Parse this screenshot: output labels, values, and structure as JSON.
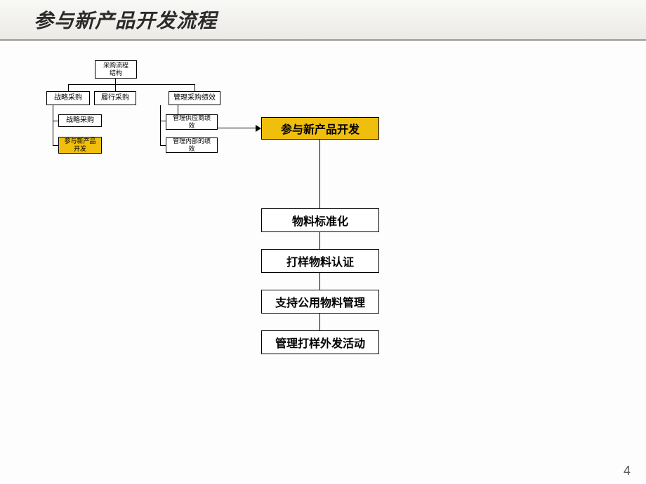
{
  "title": "参与新产品开发流程",
  "orgchart": {
    "root": "采购流程\n结构",
    "level1": {
      "a": "战略采购",
      "b": "履行采购",
      "c": "管理采购绩效"
    },
    "level2": {
      "a1": "战略采购",
      "a2": "参与新产品\n开发",
      "c1": "管理供应商绩\n效",
      "c2": "管理内部的绩\n效"
    }
  },
  "flow": {
    "main": "参与新产品开发",
    "steps": [
      "物料标准化",
      "打样物料认证",
      "支持公用物料管理",
      "管理打样外发活动"
    ]
  },
  "page_number": "4"
}
